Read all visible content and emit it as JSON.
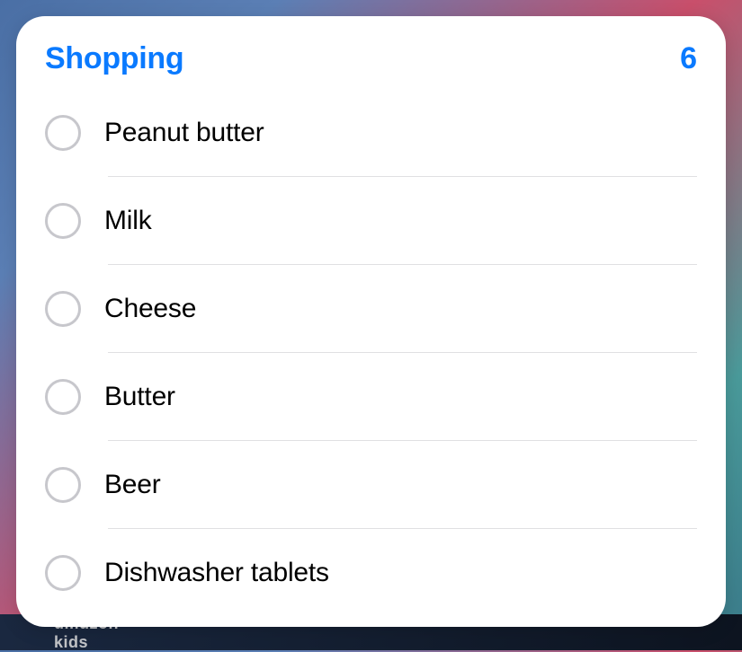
{
  "list": {
    "title": "Shopping",
    "count": "6",
    "accent_color": "#0a7aff",
    "items": [
      {
        "text": "Peanut butter",
        "completed": false
      },
      {
        "text": "Milk",
        "completed": false
      },
      {
        "text": "Cheese",
        "completed": false
      },
      {
        "text": "Butter",
        "completed": false
      },
      {
        "text": "Beer",
        "completed": false
      },
      {
        "text": "Dishwasher tablets",
        "completed": false
      }
    ]
  },
  "background": {
    "partial_text_left": "umuzon",
    "partial_text_left2": "kids",
    "partial_text_icons": ""
  }
}
